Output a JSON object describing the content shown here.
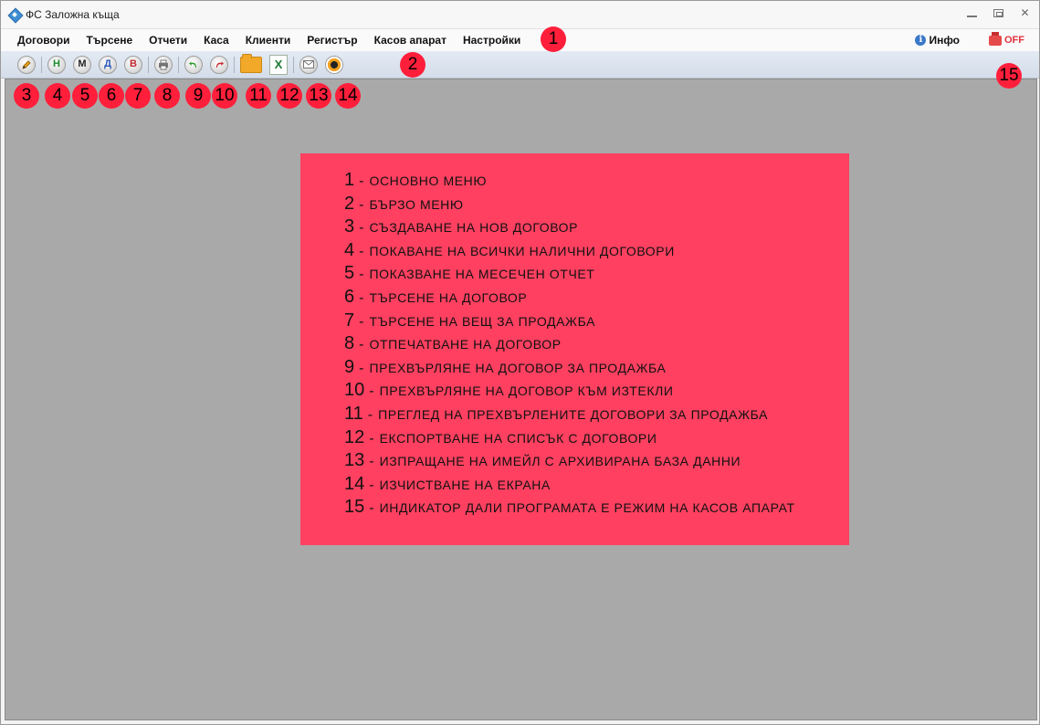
{
  "window": {
    "title": "ФС Заложна къща"
  },
  "menu": {
    "items": [
      "Договори",
      "Търсене",
      "Отчети",
      "Каса",
      "Клиенти",
      "Регистър",
      "Касов апарат",
      "Настройки"
    ],
    "info_label": "Инфо",
    "off_label": "OFF"
  },
  "toolbar": {
    "letter_n": "Н",
    "letter_m": "М",
    "letter_d": "Д",
    "letter_v": "В"
  },
  "markers": [
    "1",
    "2",
    "3",
    "4",
    "5",
    "6",
    "7",
    "8",
    "9",
    "10",
    "11",
    "12",
    "13",
    "14",
    "15"
  ],
  "legend": [
    {
      "num": "1",
      "text": "ОСНОВНО МЕНЮ"
    },
    {
      "num": "2",
      "text": "БЪРЗО МЕНЮ"
    },
    {
      "num": "3",
      "text": "СЪЗДАВАНЕ НА НОВ ДОГОВОР"
    },
    {
      "num": "4",
      "text": "ПОКАВАНЕ НА ВСИЧКИ НАЛИЧНИ ДОГОВОРИ"
    },
    {
      "num": "5",
      "text": "ПОКАЗВАНЕ НА МЕСЕЧЕН ОТЧЕТ"
    },
    {
      "num": "6",
      "text": "ТЪРСЕНЕ НА ДОГОВОР"
    },
    {
      "num": "7",
      "text": "ТЪРСЕНЕ НА ВЕЩ ЗА ПРОДАЖБА"
    },
    {
      "num": "8",
      "text": "ОТПЕЧАТВАНЕ НА ДОГОВОР"
    },
    {
      "num": "9",
      "text": "ПРЕХВЪРЛЯНЕ НА ДОГОВОР ЗА ПРОДАЖБА"
    },
    {
      "num": "10",
      "text": "ПРЕХВЪРЛЯНЕ НА ДОГОВОР КЪМ ИЗТЕКЛИ"
    },
    {
      "num": "11",
      "text": "ПРЕГЛЕД НА ПРЕХВЪРЛЕНИТЕ ДОГОВОРИ ЗА ПРОДАЖБА"
    },
    {
      "num": "12",
      "text": "ЕКСПОРТВАНЕ НА СПИСЪК С ДОГОВОРИ"
    },
    {
      "num": "13",
      "text": "ИЗПРАЩАНЕ НА ИМЕЙЛ С АРХИВИРАНА БАЗА ДАННИ"
    },
    {
      "num": "14",
      "text": "ИЗЧИСТВАНЕ НА ЕКРАНА"
    },
    {
      "num": "15",
      "text": "ИНДИКАТОР ДАЛИ ПРОГРАМАТА Е РЕЖИМ НА КАСОВ АПАРАТ"
    }
  ],
  "colors": {
    "marker": "#ff1f3b",
    "legend_bg": "#ff4060",
    "workspace": "#a9a9a9",
    "off_red": "#e0323c"
  }
}
